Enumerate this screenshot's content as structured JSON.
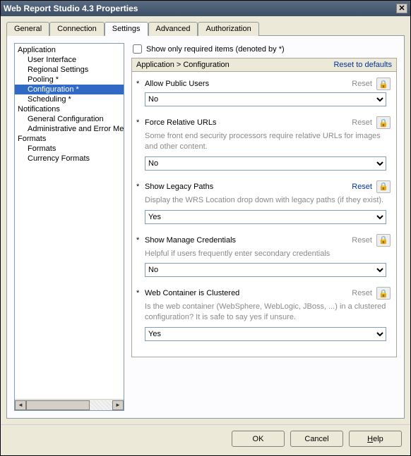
{
  "title": "Web Report Studio 4.3 Properties",
  "tabs": [
    "General",
    "Connection",
    "Settings",
    "Advanced",
    "Authorization"
  ],
  "active_tab": 2,
  "tree": {
    "items": [
      {
        "label": "Application",
        "level": 0
      },
      {
        "label": "User Interface",
        "level": 1
      },
      {
        "label": "Regional Settings",
        "level": 1
      },
      {
        "label": "Pooling *",
        "level": 1
      },
      {
        "label": "Configuration *",
        "level": 1,
        "selected": true
      },
      {
        "label": "Scheduling *",
        "level": 1
      },
      {
        "label": "Notifications",
        "level": 0
      },
      {
        "label": "General Configuration",
        "level": 1
      },
      {
        "label": "Administrative and Error Messages",
        "level": 1
      },
      {
        "label": "Formats",
        "level": 0
      },
      {
        "label": "Formats",
        "level": 1
      },
      {
        "label": "Currency Formats",
        "level": 1
      }
    ]
  },
  "show_required": {
    "checked": false,
    "label": "Show only required items (denoted by *)"
  },
  "section": {
    "breadcrumb": "Application > Configuration",
    "reset_label": "Reset to defaults"
  },
  "settings": [
    {
      "title": "Allow Public Users",
      "required": true,
      "reset_active": false,
      "desc": "",
      "value": "No"
    },
    {
      "title": "Force Relative URLs",
      "required": true,
      "reset_active": false,
      "desc": "Some front end security processors require relative URLs for images and other content.",
      "value": "No"
    },
    {
      "title": "Show Legacy Paths",
      "required": true,
      "reset_active": true,
      "desc": "Display the WRS Location drop down with legacy paths (if they exist).",
      "value": "Yes"
    },
    {
      "title": "Show Manage Credentials",
      "required": true,
      "reset_active": false,
      "desc": "Helpful if users frequently enter secondary credentials",
      "value": "No"
    },
    {
      "title": "Web Container is Clustered",
      "required": true,
      "reset_active": false,
      "desc": "Is the web container (WebSphere, WebLogic, JBoss, ...) in a clustered configuration? It is safe to say yes if unsure.",
      "value": "Yes"
    }
  ],
  "reset_label": "Reset",
  "buttons": {
    "ok": "OK",
    "cancel": "Cancel",
    "help": "Help"
  }
}
